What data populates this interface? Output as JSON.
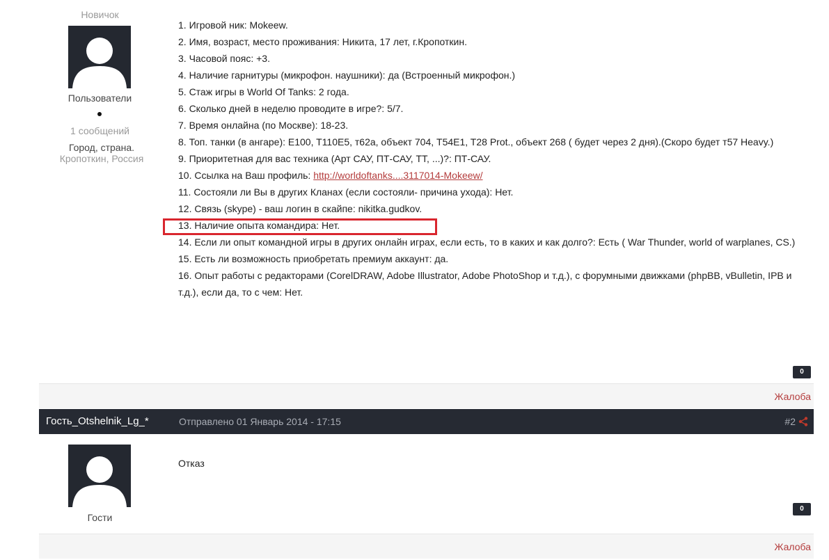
{
  "post1": {
    "author": {
      "rank": "Новичок",
      "group": "Пользователи",
      "post_count": "1 сообщений",
      "location_label": "Город, страна.",
      "location_value": "Кропоткин, Россия"
    },
    "lines": [
      "1. Игровой ник: Mokeew.",
      "2. Имя, возраст, место проживания: Никита, 17 лет, г.Кропоткин.",
      "3. Часовой пояс: +3.",
      "4. Наличие гарнитуры (микрофон. наушники): да (Встроенный микрофон.)",
      "5. Стаж игры в World Of Tanks: 2 года.",
      "6. Сколько дней в неделю проводите в игре?: 5/7.",
      "7. Время онлайна (по Москве): 18-23.",
      "8. Топ. танки (в ангаре): E100, T110E5, т62а, объект 704, T54E1, T28 Prot., объект 268 ( будет через 2 дня).(Скоро будет т57 Heavy.)",
      "9. Приоритетная для вас техника (Арт САУ, ПТ-САУ, ТТ, ...)?: ПТ-САУ."
    ],
    "profile_prefix": "10. Ссылка на Ваш профиль: ",
    "profile_link": "http://worldoftanks....3117014-Mokeew/",
    "lines_after": [
      "11. Состояли ли Вы в других Кланах (если состояли- причина ухода): Нет.",
      "12. Связь (skype) - ваш логин в скайпе: nikitka.gudkov.",
      "13. Наличие опыта командира: Нет.",
      "14. Если ли опыт командной игры в других онлайн играх, если есть, то в каких и как долго?: Есть ( War Thunder, world of warplanes, CS.)",
      "15. Есть ли возможность приобретать премиум аккаунт: да.",
      "16. Опыт работы с редакторами (CorelDRAW, Adobe Illustrator, Adobe PhotoShop и т.д.), с форумными движками (phpBB, vBulletin, IPB и т.д.), если да, то с чем: Нет."
    ],
    "reputation": "0",
    "report_label": "Жалоба"
  },
  "post2": {
    "header": {
      "author": "Гость_Otshelnik_Lg_*",
      "date": "Отправлено 01 Январь 2014 - 17:15",
      "number": "#2",
      "share_icon": "share-icon"
    },
    "author": {
      "group": "Гости"
    },
    "body": "Отказ",
    "reputation": "0",
    "report_label": "Жалоба"
  },
  "colors": {
    "header_bg": "#262a33",
    "link": "#b43c3c",
    "highlight": "#d9262e",
    "footer_bg": "#f5f5f5"
  }
}
